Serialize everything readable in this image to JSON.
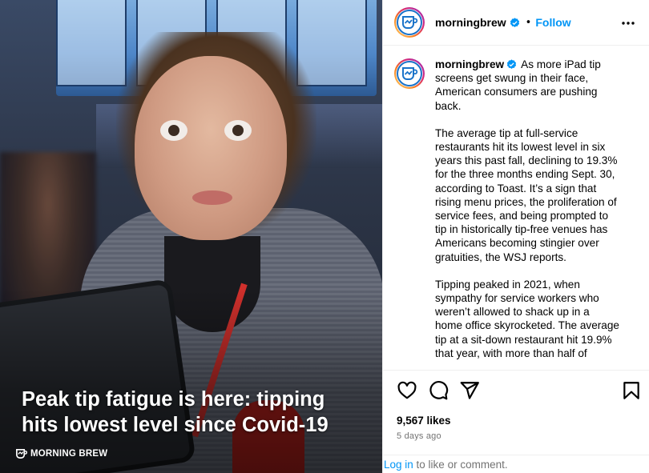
{
  "media": {
    "headline": "Peak tip fatigue is here: tipping hits lowest level since Covid-19",
    "brand_label": "MORNING BREW"
  },
  "post_header": {
    "username": "morningbrew",
    "separator": "•",
    "follow_label": "Follow",
    "more_icon": "more-options-icon"
  },
  "caption": {
    "username": "morningbrew",
    "paragraphs": [
      "As more iPad tip screens get swung in their face, American consumers are pushing back.",
      "The average tip at full-service restaurants hit its lowest level in six years this past fall, declining to 19.3% for the three months ending Sept. 30, according to Toast. It’s a sign that rising menu prices, the proliferation of service fees, and being prompted to tip in historically tip-free venues has Americans becoming stingier over gratuities, the WSJ reports.",
      "Tipping peaked in 2021, when sympathy for service workers who weren’t allowed to shack up in a home office skyrocketed. The average tip at a sit-down restaurant hit 19.9% that year, with more than half of"
    ]
  },
  "actions": {
    "icons": [
      "heart-icon",
      "comment-icon",
      "share-icon",
      "bookmark-icon"
    ]
  },
  "stats": {
    "likes": "9,567 likes",
    "age": "5 days ago"
  },
  "footer": {
    "login_link": "Log in",
    "login_suffix": " to like or comment."
  },
  "colors": {
    "accent": "#0095f6",
    "muted": "#737373",
    "divider": "#efefef"
  }
}
